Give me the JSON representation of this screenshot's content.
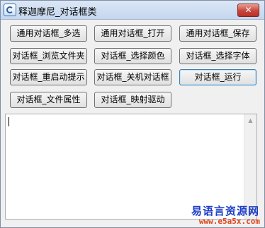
{
  "window": {
    "title": "释迦摩尼_对话框类",
    "close_glyph": "✕"
  },
  "buttons": [
    "通用对话框_多选",
    "通用对话框_打开",
    "通用对话框_保存",
    "对话框_浏览文件夹",
    "对话框_选择颜色",
    "对话框_选择字体",
    "对话框_重启动提示",
    "对话框_关机对话框",
    "对话框_运行",
    "对话框_文件属性",
    "对话框_映射驱动"
  ],
  "textarea": {
    "value": ""
  },
  "scrollbar": {
    "up_glyph": "▲",
    "down_glyph": "▼"
  },
  "watermark": {
    "site_name": "易语言资源网",
    "url": "www.e5a5x.com"
  }
}
